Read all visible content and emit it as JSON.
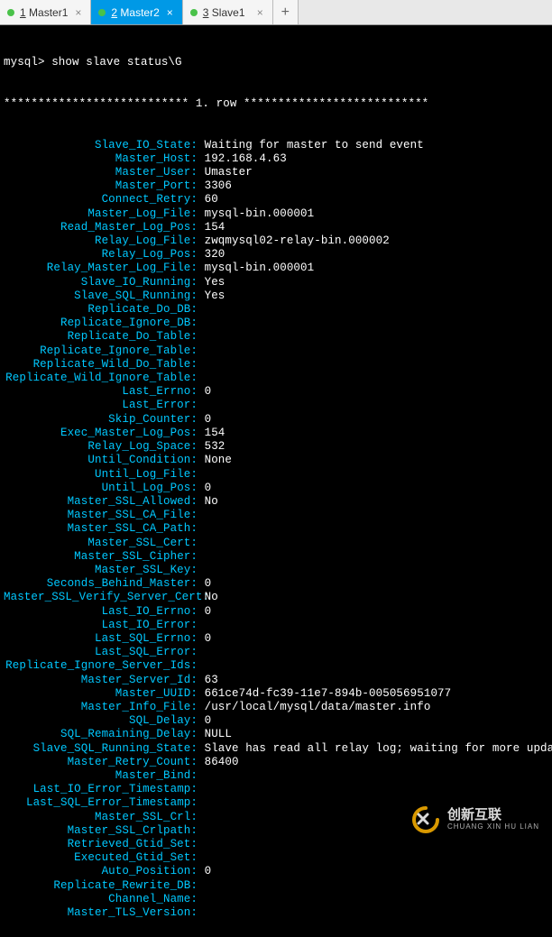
{
  "tabs": [
    {
      "num": "1",
      "label": "Master1",
      "active": false
    },
    {
      "num": "2",
      "label": "Master2",
      "active": true
    },
    {
      "num": "3",
      "label": "Slave1",
      "active": false
    }
  ],
  "prompt": "mysql> show slave status\\G",
  "row_separator_left": "***************************",
  "row_marker": " 1. row ",
  "row_separator_right": "***************************",
  "fields": [
    {
      "k": "Slave_IO_State",
      "v": "Waiting for master to send event"
    },
    {
      "k": "Master_Host",
      "v": "192.168.4.63"
    },
    {
      "k": "Master_User",
      "v": "Umaster"
    },
    {
      "k": "Master_Port",
      "v": "3306"
    },
    {
      "k": "Connect_Retry",
      "v": "60"
    },
    {
      "k": "Master_Log_File",
      "v": "mysql-bin.000001"
    },
    {
      "k": "Read_Master_Log_Pos",
      "v": "154"
    },
    {
      "k": "Relay_Log_File",
      "v": "zwqmysql02-relay-bin.000002"
    },
    {
      "k": "Relay_Log_Pos",
      "v": "320"
    },
    {
      "k": "Relay_Master_Log_File",
      "v": "mysql-bin.000001"
    },
    {
      "k": "Slave_IO_Running",
      "v": "Yes"
    },
    {
      "k": "Slave_SQL_Running",
      "v": "Yes"
    },
    {
      "k": "Replicate_Do_DB",
      "v": ""
    },
    {
      "k": "Replicate_Ignore_DB",
      "v": ""
    },
    {
      "k": "Replicate_Do_Table",
      "v": ""
    },
    {
      "k": "Replicate_Ignore_Table",
      "v": ""
    },
    {
      "k": "Replicate_Wild_Do_Table",
      "v": ""
    },
    {
      "k": "Replicate_Wild_Ignore_Table",
      "v": ""
    },
    {
      "k": "Last_Errno",
      "v": "0"
    },
    {
      "k": "Last_Error",
      "v": ""
    },
    {
      "k": "Skip_Counter",
      "v": "0"
    },
    {
      "k": "Exec_Master_Log_Pos",
      "v": "154"
    },
    {
      "k": "Relay_Log_Space",
      "v": "532"
    },
    {
      "k": "Until_Condition",
      "v": "None"
    },
    {
      "k": "Until_Log_File",
      "v": ""
    },
    {
      "k": "Until_Log_Pos",
      "v": "0"
    },
    {
      "k": "Master_SSL_Allowed",
      "v": "No"
    },
    {
      "k": "Master_SSL_CA_File",
      "v": ""
    },
    {
      "k": "Master_SSL_CA_Path",
      "v": ""
    },
    {
      "k": "Master_SSL_Cert",
      "v": ""
    },
    {
      "k": "Master_SSL_Cipher",
      "v": ""
    },
    {
      "k": "Master_SSL_Key",
      "v": ""
    },
    {
      "k": "Seconds_Behind_Master",
      "v": "0"
    },
    {
      "k": "Master_SSL_Verify_Server_Cert",
      "v": "No"
    },
    {
      "k": "Last_IO_Errno",
      "v": "0"
    },
    {
      "k": "Last_IO_Error",
      "v": ""
    },
    {
      "k": "Last_SQL_Errno",
      "v": "0"
    },
    {
      "k": "Last_SQL_Error",
      "v": ""
    },
    {
      "k": "Replicate_Ignore_Server_Ids",
      "v": ""
    },
    {
      "k": "Master_Server_Id",
      "v": "63"
    },
    {
      "k": "Master_UUID",
      "v": "661ce74d-fc39-11e7-894b-005056951077"
    },
    {
      "k": "Master_Info_File",
      "v": "/usr/local/mysql/data/master.info"
    },
    {
      "k": "SQL_Delay",
      "v": "0"
    },
    {
      "k": "SQL_Remaining_Delay",
      "v": "NULL"
    },
    {
      "k": "Slave_SQL_Running_State",
      "v": "Slave has read all relay log; waiting for more updates"
    },
    {
      "k": "Master_Retry_Count",
      "v": "86400"
    },
    {
      "k": "Master_Bind",
      "v": ""
    },
    {
      "k": "Last_IO_Error_Timestamp",
      "v": ""
    },
    {
      "k": "Last_SQL_Error_Timestamp",
      "v": ""
    },
    {
      "k": "Master_SSL_Crl",
      "v": ""
    },
    {
      "k": "Master_SSL_Crlpath",
      "v": ""
    },
    {
      "k": "Retrieved_Gtid_Set",
      "v": ""
    },
    {
      "k": "Executed_Gtid_Set",
      "v": ""
    },
    {
      "k": "Auto_Position",
      "v": "0"
    },
    {
      "k": "Replicate_Rewrite_DB",
      "v": ""
    },
    {
      "k": "Channel_Name",
      "v": ""
    },
    {
      "k": "Master_TLS_Version",
      "v": ""
    }
  ],
  "watermark": {
    "cn": "创新互联",
    "en": "CHUANG XIN HU LIAN"
  }
}
